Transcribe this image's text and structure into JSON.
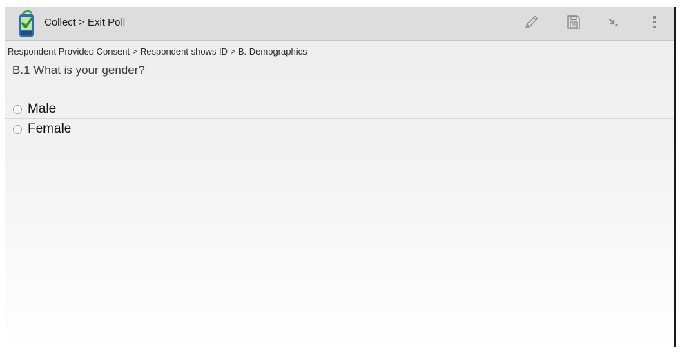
{
  "action_bar": {
    "title": "Collect > Exit Poll",
    "logo_icon": "collect-app-logo",
    "actions": [
      {
        "name": "edit",
        "icon": "pencil-icon"
      },
      {
        "name": "save",
        "icon": "save-disk-icon"
      },
      {
        "name": "hierarchy",
        "icon": "jump-arrow-icon"
      },
      {
        "name": "overflow",
        "icon": "more-vert-icon"
      }
    ]
  },
  "breadcrumb": "Respondent Provided Consent > Respondent shows ID > B. Demographics",
  "question": {
    "label": "B.1 What is your gender?",
    "options": [
      {
        "label": "Male",
        "selected": false
      },
      {
        "label": "Female",
        "selected": false
      }
    ]
  },
  "colors": {
    "action_bar_bg": "#dddddd",
    "logo_green": "#3aa33a",
    "logo_blue": "#2c6fb0",
    "icon_gray": "#8a8a8a"
  }
}
